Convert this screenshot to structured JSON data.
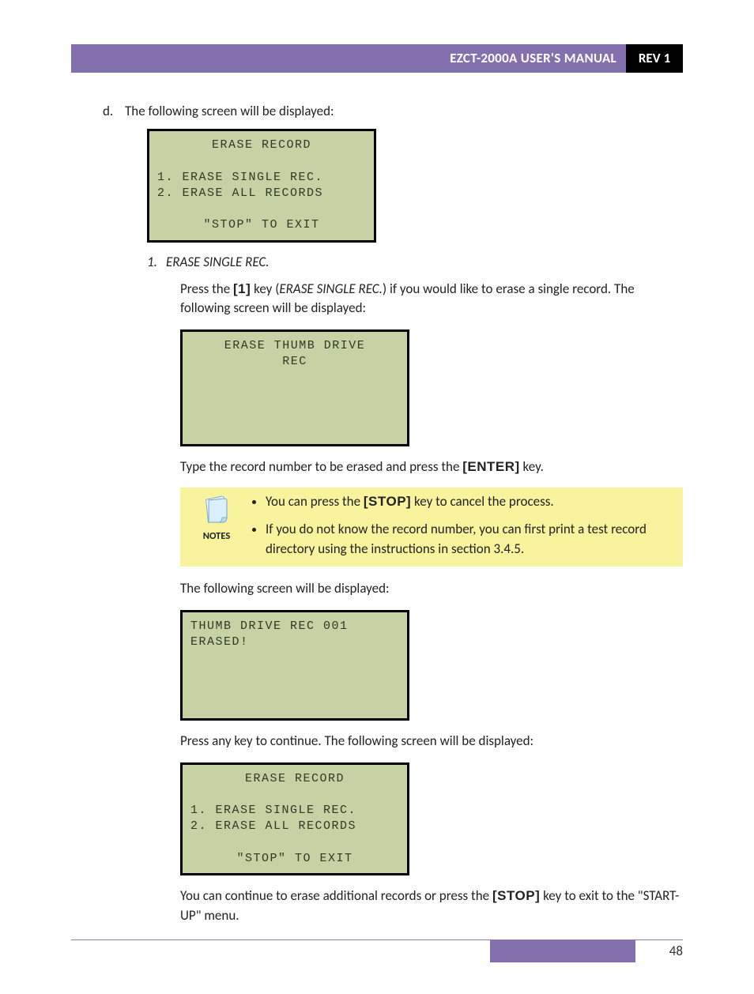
{
  "header": {
    "title": "EZCT-2000A USER'S MANUAL",
    "rev": "REV 1"
  },
  "step_d": {
    "letter": "d.",
    "text": "The following screen will be displayed:"
  },
  "lcd1": {
    "l1": "ERASE RECORD",
    "l2": "1. ERASE SINGLE REC.",
    "l3": "2. ERASE ALL RECORDS",
    "l4": "\"STOP\" TO EXIT"
  },
  "sub1": {
    "num": "1.",
    "title": "ERASE SINGLE REC."
  },
  "p1": {
    "a": "Press the ",
    "key": "[1]",
    "b": " key (",
    "em": "ERASE SINGLE REC.",
    "c": ") if you would like to erase a single record. The following screen will be displayed:"
  },
  "lcd2": {
    "l1": "ERASE THUMB DRIVE",
    "l2": "REC"
  },
  "p2": {
    "a": "Type the record number to be erased and press the ",
    "key": "[ENTER]",
    "b": " key."
  },
  "notes": {
    "label": "NOTES",
    "bullet1a": "You can press the ",
    "bullet1key": "[STOP]",
    "bullet1b": " key to cancel the process.",
    "bullet2": "If you do not know the record number, you can first print a test record directory using the instructions in section 3.4.5."
  },
  "p3": "The following screen will be displayed:",
  "lcd3": {
    "l1": "THUMB DRIVE REC 001",
    "l2": "ERASED!"
  },
  "p4": "Press any key to continue. The following screen will be displayed:",
  "lcd4": {
    "l1": "ERASE RECORD",
    "l2": "1. ERASE SINGLE REC.",
    "l3": "2. ERASE ALL RECORDS",
    "l4": "\"STOP\" TO EXIT"
  },
  "p5": {
    "a": "You can continue to erase additional records or press the ",
    "key": "[STOP]",
    "b": " key to exit to the \"START-UP\" menu."
  },
  "footer": {
    "page": "48"
  }
}
